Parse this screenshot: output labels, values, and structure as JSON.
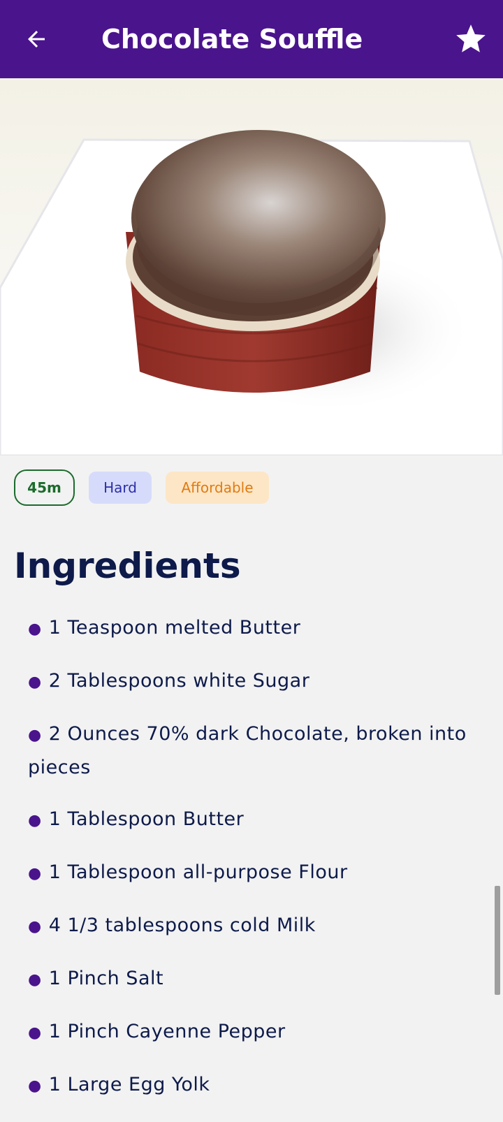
{
  "app_bar": {
    "title": "Chocolate Souffle",
    "back_icon": "arrow-left-icon",
    "favorite_icon": "star-icon",
    "color": "#4a148c"
  },
  "hero_image": {
    "alt": "Chocolate Souffle"
  },
  "tags": {
    "duration": "45m",
    "complexity": "Hard",
    "affordability": "Affordable"
  },
  "ingredients": {
    "title": "Ingredients",
    "items": [
      "1 Teaspoon melted Butter",
      "2 Tablespoons white Sugar",
      "2 Ounces 70% dark Chocolate, broken into pieces",
      "1 Tablespoon Butter",
      "1 Tablespoon all-purpose Flour",
      "4 1/3 tablespoons cold Milk",
      "1 Pinch Salt",
      "1 Pinch Cayenne Pepper",
      "1 Large Egg Yolk"
    ]
  }
}
